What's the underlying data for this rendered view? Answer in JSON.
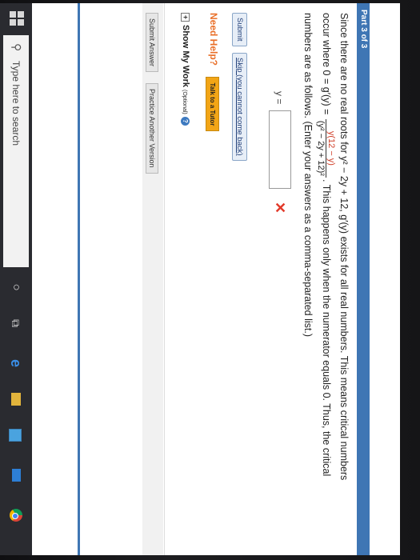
{
  "part": {
    "label": "Part 3 of 3"
  },
  "problem": {
    "line1_a": "Since there are no real roots for ",
    "line1_expr": "y² − 2y + 12",
    "line1_b": ", g′(y) exists for all real numbers. This means critical numbers",
    "line2_a": "occur where 0 = g′(y) =",
    "frac_num": "y(12 − y)",
    "frac_den": "(y² − 2y + 12)²",
    "line2_b": ". This happens only when the numerator equals 0. Thus, the critical",
    "line3": "numbers are as follows. (Enter your answers as a comma-separated list.)"
  },
  "answer": {
    "label": "y =",
    "value": "",
    "status_icon": "✕"
  },
  "buttons": {
    "submit": "Submit",
    "skip": "Skip (you cannot come back)"
  },
  "help": {
    "need_help": "Need Help?",
    "tutor": "Talk to a Tutor"
  },
  "show_work": {
    "expander": "+",
    "label": "Show My Work",
    "optional": "(Optional)",
    "help_glyph": "?"
  },
  "footer": {
    "submit_answer": "Submit Answer",
    "practice": "Practice Another Version"
  },
  "taskbar": {
    "search_placeholder": "Type here to search",
    "search_glyph": "⚲",
    "cortana_glyph": "○",
    "taskview_glyph": "⧉",
    "edge_glyph": "e"
  },
  "colors": {
    "accent_blue": "#3f76b4",
    "need_help_orange": "#e9702a",
    "tutor_yellow": "#f2a516",
    "error_red": "#e23a2a"
  }
}
